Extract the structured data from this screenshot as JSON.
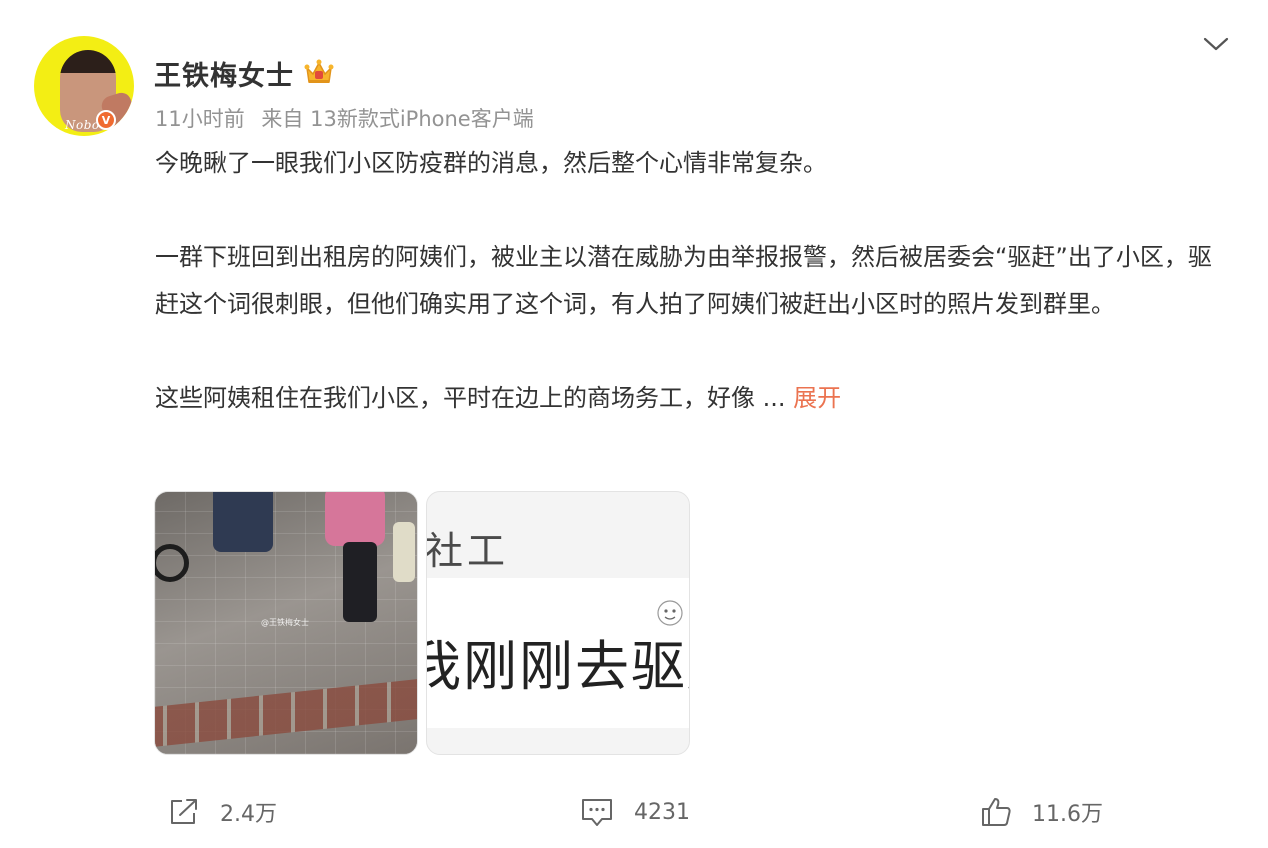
{
  "post": {
    "author": {
      "name": "王铁梅女士",
      "avatar_caption": "Nobo",
      "verified_badge": "V",
      "crown_icon": "crown-icon"
    },
    "meta": {
      "time": "11小时前",
      "source": "来自 13新款式iPhone客户端"
    },
    "content": {
      "paragraphs": [
        "今晚瞅了一眼我们小区防疫群的消息，然后整个心情非常复杂。",
        "一群下班回到出租房的阿姨们，被业主以潜在威胁为由举报报警，然后被居委会“驱赶”出了小区，驱赶这个词很刺眼，但他们确实用了这个词，有人拍了阿姨们被赶出小区时的照片发到群里。",
        "这些阿姨租住在我们小区，平时在边上的商场务工，好像"
      ],
      "ellipsis": "...",
      "expand_label": "展开"
    },
    "images": [
      {
        "watermark": "@王铁梅女士"
      },
      {
        "label": "社工",
        "text": "我刚刚去驱赶"
      }
    ],
    "actions": {
      "share_count": "2.4万",
      "comment_count": "4231",
      "like_count": "11.6万"
    }
  },
  "colors": {
    "accent": "#eb7350",
    "meta_text": "#939393",
    "body_text": "#333333",
    "verify_badge": "#f06b30",
    "avatar_bg": "#f3ee14"
  }
}
